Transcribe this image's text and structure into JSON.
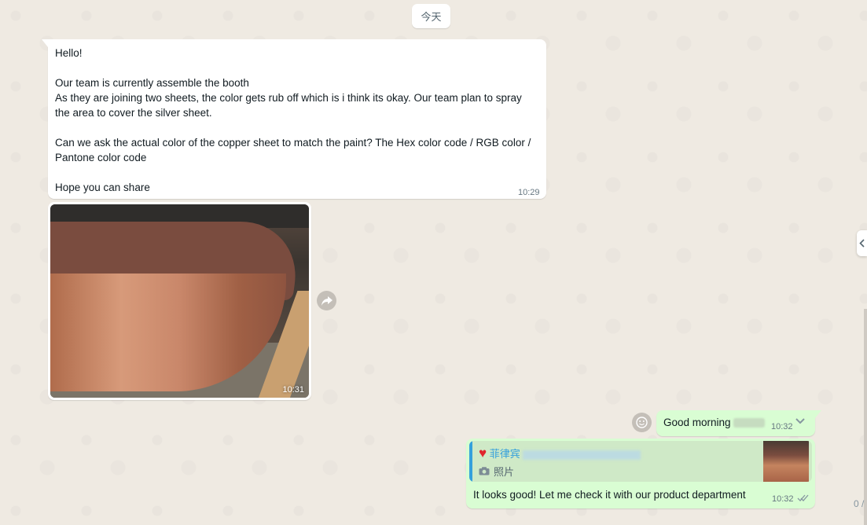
{
  "date_chip": "今天",
  "incoming": {
    "text": "Hello!\n\nOur team is currently assemble the booth\nAs they are joining two sheets, the color gets rub off which is i think its okay. Our team plan to spray the area to cover the silver sheet.\n\nCan we ask the actual color of the copper sheet to match the paint? The Hex color code / RGB color / Pantone color code\n\nHope you can share",
    "time": "10:29"
  },
  "image_message": {
    "time": "10:31"
  },
  "outgoing1": {
    "text": "Good morning",
    "time": "10:32"
  },
  "outgoing2": {
    "quote_author": "菲律宾",
    "quote_kind": "照片",
    "text": "It looks good! Let me check it with our product department",
    "time": "10:32"
  },
  "page_count": "0 /",
  "colors": {
    "outgoing_bg": "#d9fdd3",
    "incoming_bg": "#ffffff",
    "chat_bg": "#efeae2",
    "quote_accent": "#35a0dc"
  }
}
